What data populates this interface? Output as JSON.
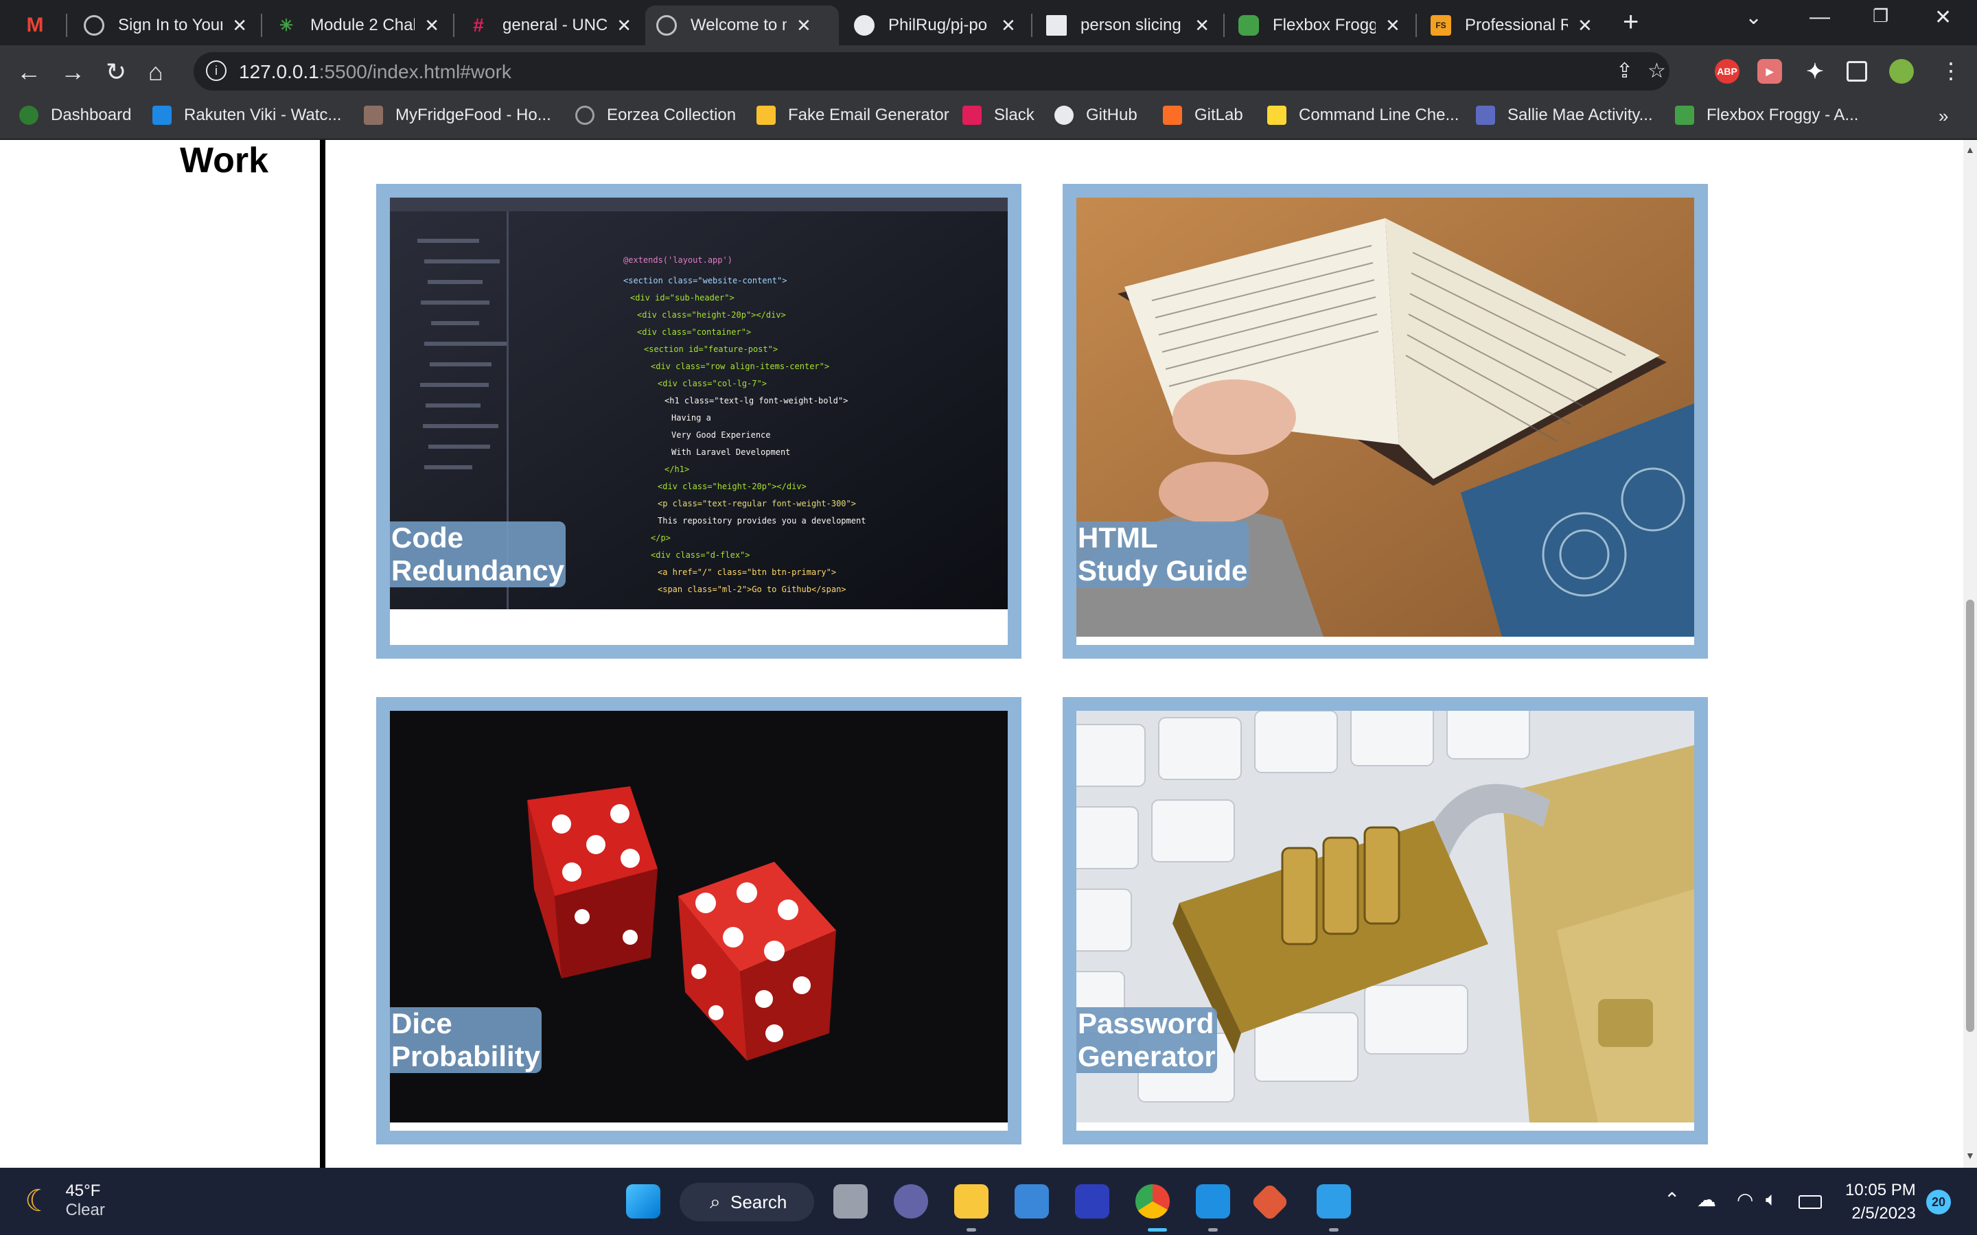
{
  "tabs": [
    {
      "title": "",
      "icon": "gmail-icon",
      "active": false
    },
    {
      "title": "Sign In to Your",
      "icon": "globe-icon",
      "active": false
    },
    {
      "title": "Module 2 Chal",
      "icon": "canvas-icon",
      "active": false
    },
    {
      "title": "general - UNC",
      "icon": "slack-icon",
      "active": false
    },
    {
      "title": "Welcome to m",
      "icon": "globe-icon",
      "active": true
    },
    {
      "title": "PhilRug/pj-po",
      "icon": "github-icon",
      "active": false
    },
    {
      "title": "person slicing",
      "icon": "unsplash-icon",
      "active": false
    },
    {
      "title": "Flexbox Frogg",
      "icon": "frog-icon",
      "active": false
    },
    {
      "title": "Professional R",
      "icon": "fs-icon",
      "active": false
    }
  ],
  "omnibox": {
    "url_host": "127.0.0.1",
    "url_rest": ":5500/index.html#work"
  },
  "bookmarks": [
    {
      "label": "Dashboard",
      "icon": "canvas-icon",
      "color": "#2e7d32"
    },
    {
      "label": "Rakuten Viki - Watc...",
      "icon": "viki-icon",
      "color": "#1e88e5"
    },
    {
      "label": "MyFridgeFood - Ho...",
      "icon": "fridge-icon",
      "color": "#8d6e63"
    },
    {
      "label": "Eorzea Collection",
      "icon": "globe-icon",
      "color": "#9aa0a6"
    },
    {
      "label": "Fake Email Generator",
      "icon": "mail-icon",
      "color": "#fbc02d"
    },
    {
      "label": "Slack",
      "icon": "slack-icon",
      "color": "#e01e5a"
    },
    {
      "label": "GitHub",
      "icon": "github-icon",
      "color": "#e8eaed"
    },
    {
      "label": "GitLab",
      "icon": "gitlab-icon",
      "color": "#fc6d26"
    },
    {
      "label": "Command Line Che...",
      "icon": "terminal-icon",
      "color": "#fdd835"
    },
    {
      "label": "Sallie Mae Activity...",
      "icon": "salliemae-icon",
      "color": "#5c6bc0"
    },
    {
      "label": "Flexbox Froggy - A...",
      "icon": "frog-icon",
      "color": "#43a047"
    }
  ],
  "page": {
    "section_title": "Work",
    "projects": [
      {
        "line1": "Code",
        "line2": "Redundancy",
        "image": "code-screen"
      },
      {
        "line1": "HTML",
        "line2": "Study Guide",
        "image": "open-book"
      },
      {
        "line1": "Dice",
        "line2": "Probability",
        "image": "red-dice"
      },
      {
        "line1": "Password",
        "line2": "Generator",
        "image": "padlock-keyboard"
      }
    ]
  },
  "taskbar": {
    "weather_temp": "45°F",
    "weather_desc": "Clear",
    "search_label": "Search",
    "time": "10:05 PM",
    "date": "2/5/2023",
    "notifications": "20"
  },
  "colors": {
    "card_border": "#8fb5d8",
    "caption_bg": "#7097bd",
    "chrome_dark": "#202124",
    "chrome_toolbar": "#35363a",
    "taskbar_bg": "#1c2236"
  }
}
